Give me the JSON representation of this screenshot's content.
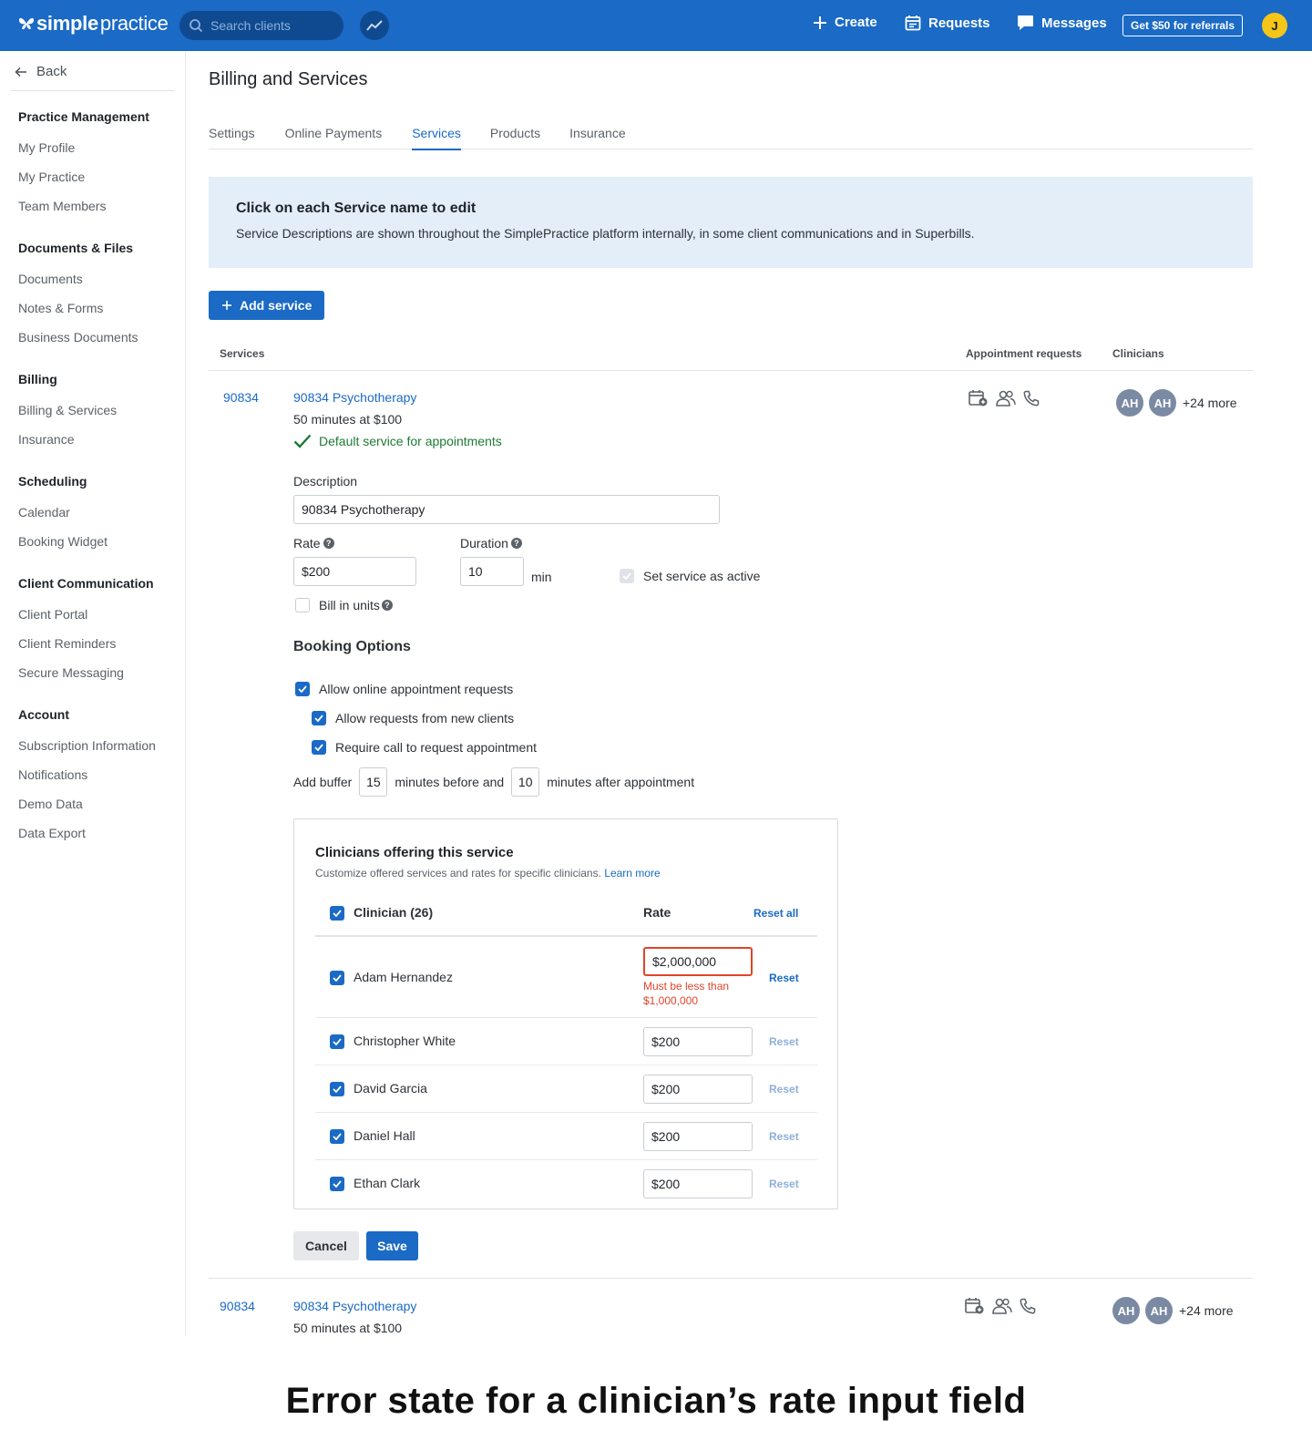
{
  "topbar": {
    "logo_bold": "simple",
    "logo_light": "practice",
    "search_placeholder": "Search clients",
    "create_label": "Create",
    "requests_label": "Requests",
    "messages_label": "Messages",
    "referral_label": "Get $50 for referrals",
    "user_initial": "J",
    "brand_color": "#1a6ac6"
  },
  "sidebar": {
    "back_label": "Back",
    "sections": [
      {
        "title": "Practice Management",
        "items": [
          "My Profile",
          "My Practice",
          "Team Members"
        ]
      },
      {
        "title": "Documents & Files",
        "items": [
          "Documents",
          "Notes & Forms",
          "Business Documents"
        ]
      },
      {
        "title": "Billing",
        "items": [
          "Billing & Services",
          "Insurance"
        ]
      },
      {
        "title": "Scheduling",
        "items": [
          "Calendar",
          "Booking Widget"
        ]
      },
      {
        "title": "Client Communication",
        "items": [
          "Client Portal",
          "Client Reminders",
          "Secure Messaging"
        ]
      },
      {
        "title": "Account",
        "items": [
          "Subscription Information",
          "Notifications",
          "Demo Data",
          "Data Export"
        ]
      }
    ]
  },
  "main": {
    "title": "Billing and Services",
    "tabs": [
      {
        "label": "Settings"
      },
      {
        "label": "Online Payments"
      },
      {
        "label": "Services"
      },
      {
        "label": "Products"
      },
      {
        "label": "Insurance"
      }
    ],
    "active_tab": "Services",
    "info_title": "Click on each Service name to edit",
    "info_text": "Service Descriptions are shown throughout the SimplePractice platform internally, in some client communications and in Superbills.",
    "add_service_label": "Add service",
    "columns": {
      "services": "Services",
      "appointment_requests": "Appointment requests",
      "clinicians": "Clinicians"
    }
  },
  "service1": {
    "code": "90834",
    "name": "90834 Psychotherapy",
    "meta": "50 minutes at $100",
    "default_label": "Default service for appointments",
    "clinician_initials": [
      "AH",
      "AH"
    ],
    "more_label": "+24 more",
    "form": {
      "description_label": "Description",
      "description_value": "90834 Psychotherapy",
      "rate_label": "Rate",
      "rate_value": "$200",
      "duration_label": "Duration",
      "duration_value": "10",
      "duration_unit": "min",
      "active_label": "Set service as active",
      "active_checked": true,
      "bill_units_label": "Bill in units",
      "bill_units_checked": false
    },
    "booking": {
      "title": "Booking Options",
      "allow_online_label": "Allow online appointment requests",
      "allow_new_label": "Allow requests from new clients",
      "require_call_label": "Require call to request appointment",
      "buffer_prefix": "Add buffer",
      "buffer_before": "15",
      "buffer_middle": "minutes before and",
      "buffer_after": "10",
      "buffer_suffix": "minutes after appointment"
    },
    "clinicians_card": {
      "title": "Clinicians offering this service",
      "description": "Customize offered services and rates for specific clinicians.",
      "learn_more": "Learn more",
      "head_name": "Clinician (26)",
      "head_rate": "Rate",
      "reset_all": "Reset all",
      "rows": [
        {
          "name": "Adam Hernandez",
          "rate": "$2,000,000",
          "error": "Must be less than $1,000,000",
          "reset": "Reset"
        },
        {
          "name": "Christopher White",
          "rate": "$200",
          "reset": "Reset"
        },
        {
          "name": "David Garcia",
          "rate": "$200",
          "reset": "Reset"
        },
        {
          "name": "Daniel Hall",
          "rate": "$200",
          "reset": "Reset"
        },
        {
          "name": "Ethan Clark",
          "rate": "$200",
          "reset": "Reset"
        }
      ],
      "error_color": "#e0452b"
    },
    "cancel_label": "Cancel",
    "save_label": "Save"
  },
  "service2": {
    "code": "90834",
    "name": "90834 Psychotherapy",
    "meta": "50 minutes at $100",
    "clinician_initials": [
      "AH",
      "AH"
    ],
    "more_label": "+24 more"
  },
  "caption": "Error state for a clinician’s rate input field"
}
